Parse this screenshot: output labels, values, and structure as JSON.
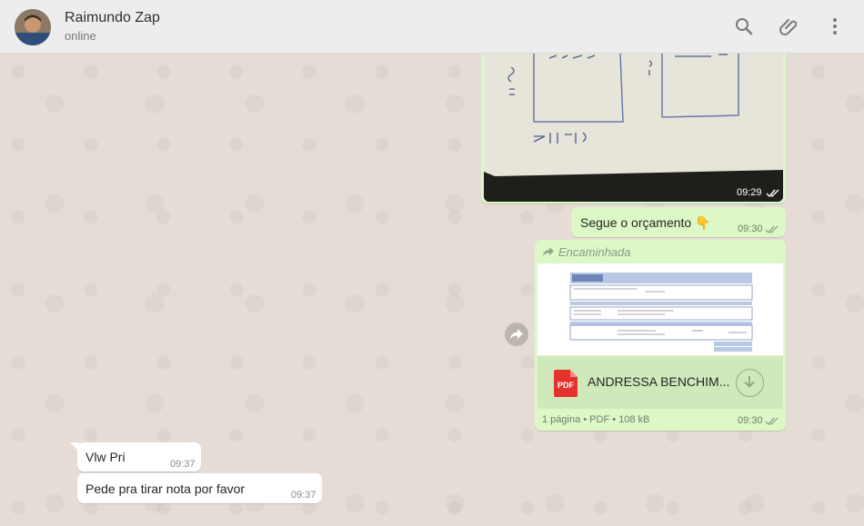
{
  "header": {
    "contact_name": "Raimundo Zap",
    "status": "online",
    "icons": [
      "search-icon",
      "attach-icon",
      "menu-icon"
    ]
  },
  "messages": {
    "photo": {
      "time": "09:29"
    },
    "budget": {
      "text": "Segue o orçamento 👇",
      "time": "09:30"
    },
    "document": {
      "forwarded_label": "Encaminhada",
      "file_name": "ANDRESSA BENCHIM...",
      "file_type_badge": "PDF",
      "meta": "1 página • PDF • 108 kB",
      "time": "09:30"
    },
    "in1": {
      "text": "Vlw Pri",
      "time": "09:37"
    },
    "in2": {
      "text": "Pede pra tirar nota por favor",
      "time": "09:37"
    }
  },
  "colors": {
    "outgoing_bubble": "#dcf8c6",
    "incoming_bubble": "#ffffff",
    "chat_background": "#e5ddd5",
    "pdf_badge": "#e5322d"
  }
}
